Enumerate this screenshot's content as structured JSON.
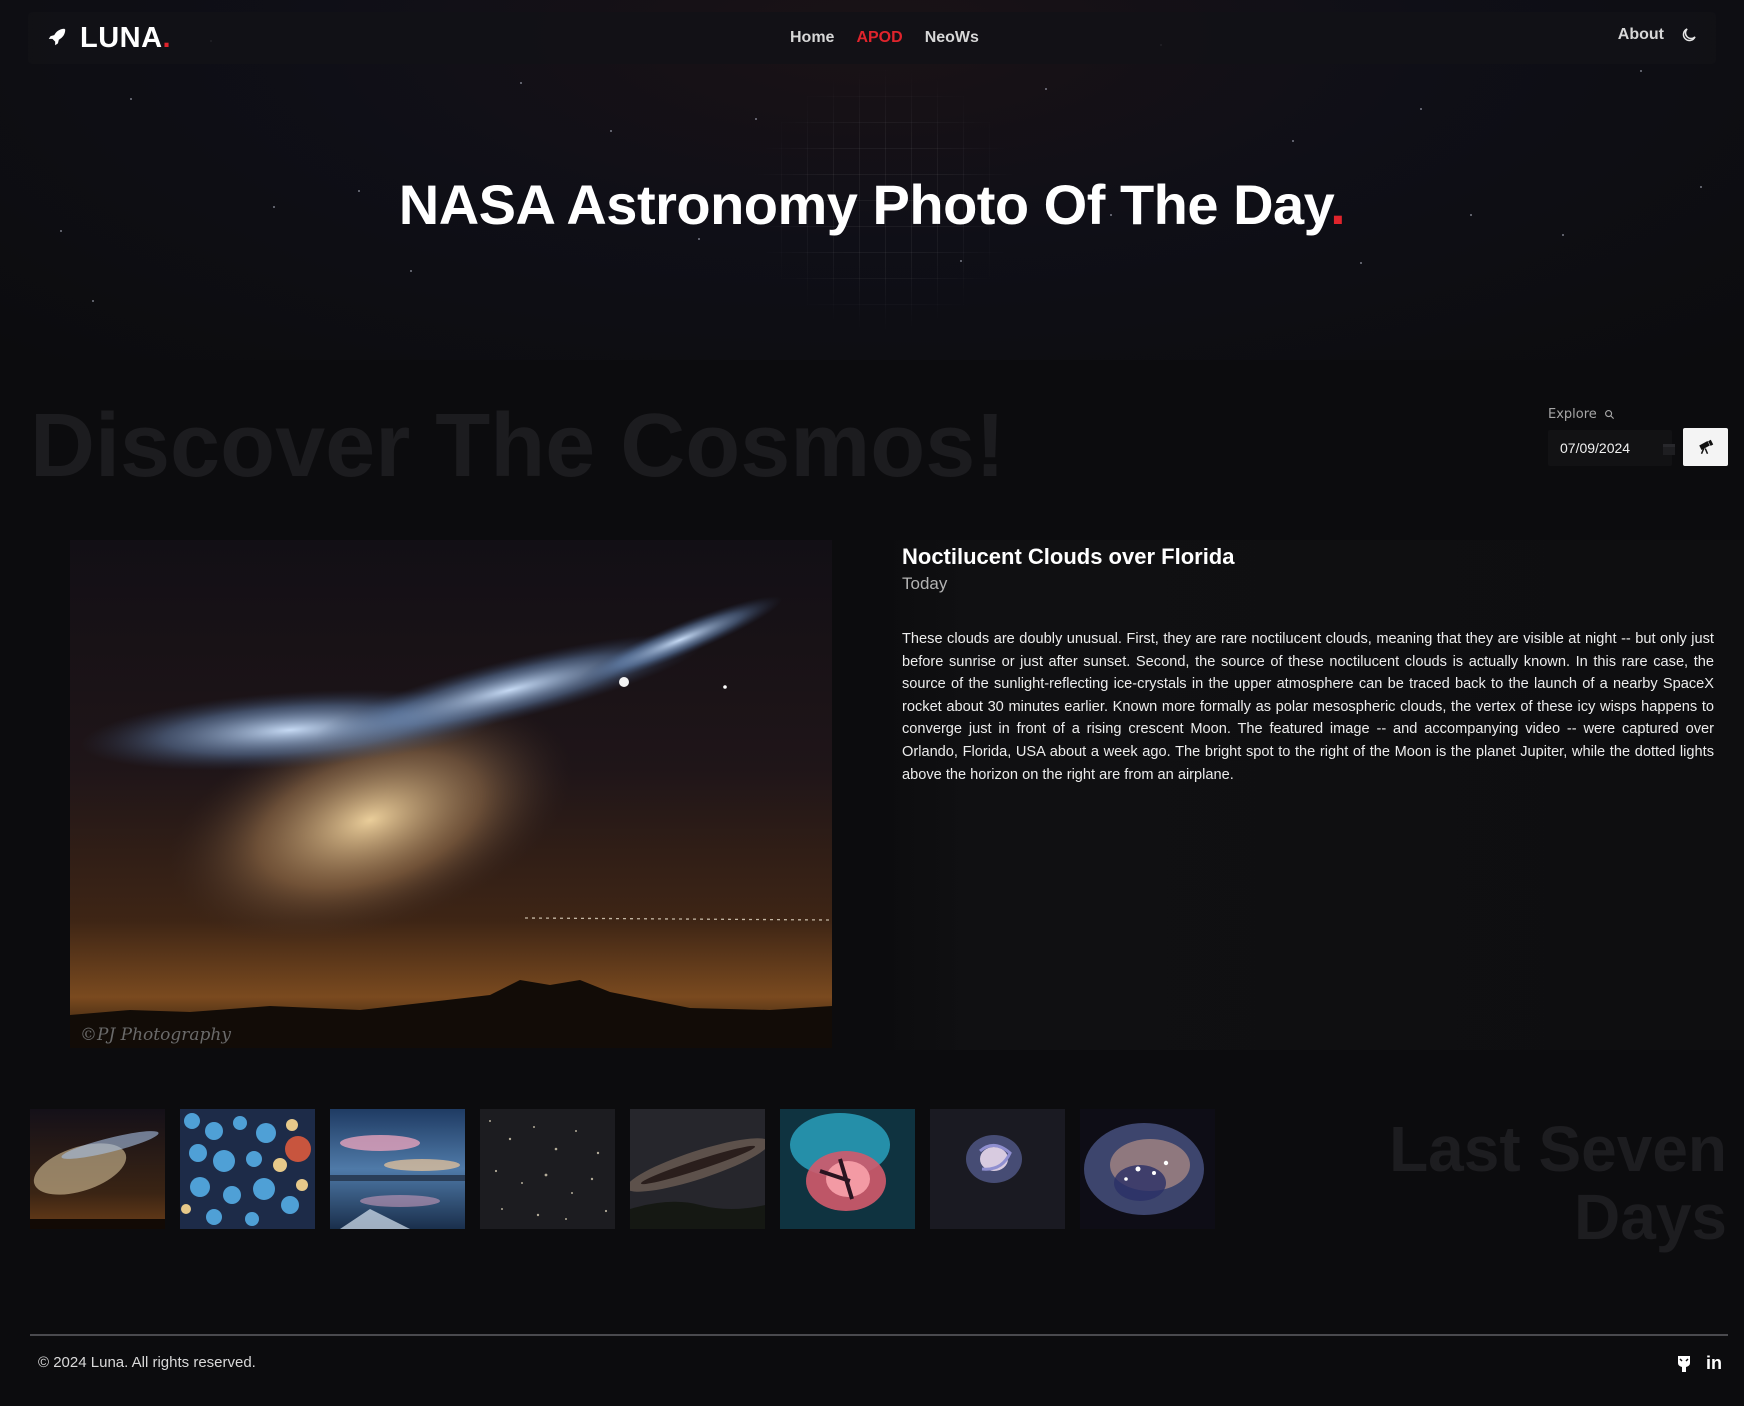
{
  "brand": {
    "name": "LUNA",
    "dot": "."
  },
  "nav": {
    "items": [
      {
        "label": "Home",
        "active": false
      },
      {
        "label": "APOD",
        "active": true
      },
      {
        "label": "NeoWs",
        "active": false
      }
    ],
    "about_label": "About",
    "theme_icon": "moon-icon"
  },
  "hero": {
    "title": "NASA Astronomy Photo Of The Day",
    "dot": "."
  },
  "discover_heading": "Discover The Cosmos!",
  "explore": {
    "label": "Explore",
    "date_value": "07/09/2024",
    "button_icon": "telescope-icon"
  },
  "apod": {
    "title": "Noctilucent Clouds over Florida",
    "date_label": "Today",
    "watermark": "©PJ Photography",
    "description": "These clouds are doubly unusual. First, they are rare noctilucent clouds, meaning that they are visible at night -- but only just before sunrise or just after sunset. Second, the source of these noctilucent clouds is actually known. In this rare case, the source of the sunlight-reflecting ice-crystals in the upper atmosphere can be traced back to the launch of a nearby SpaceX rocket about 30 minutes earlier. Known more formally as polar mesospheric clouds, the vertex of these icy wisps happens to converge just in front of a rising crescent Moon. The featured image -- and accompanying video -- were captured over Orlando, Florida, USA about a week ago. The bright spot to the right of the Moon is the planet Jupiter, while the dotted lights above the horizon on the right are from an airplane."
  },
  "last_seven": {
    "heading_line1": "Last Seven",
    "heading_line2": "Days"
  },
  "footer": {
    "copyright": "© 2024 Luna. All rights reserved.",
    "socials": [
      "github-icon",
      "linkedin-icon"
    ]
  },
  "colors": {
    "accent": "#e0242c",
    "background": "#0c0c0e"
  }
}
